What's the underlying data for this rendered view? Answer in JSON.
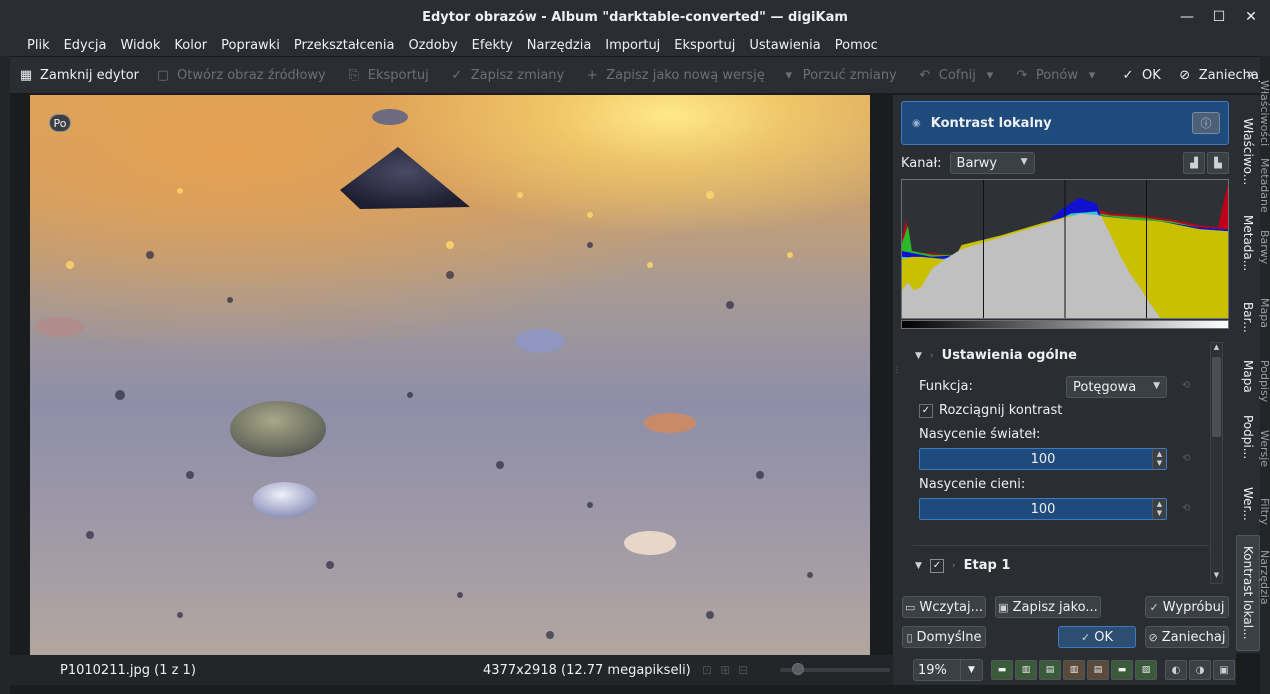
{
  "window": {
    "title": "Edytor obrazów - Album \"darktable-converted\" — digiKam"
  },
  "menu": [
    "Plik",
    "Edycja",
    "Widok",
    "Kolor",
    "Poprawki",
    "Przekształcenia",
    "Ozdoby",
    "Efekty",
    "Narzędzia",
    "Importuj",
    "Eksportuj",
    "Ustawienia",
    "Pomoc"
  ],
  "toolbar": {
    "close_editor": "Zamknij edytor",
    "open_source": "Otwórz obraz źródłowy",
    "export": "Eksportuj",
    "save_changes": "Zapisz zmiany",
    "save_new_version": "Zapisz jako nową wersję",
    "discard_changes": "Porzuć zmiany",
    "undo": "Cofnij",
    "redo": "Ponów",
    "ok": "OK",
    "cancel": "Zaniechaj",
    "more": "»"
  },
  "canvas": {
    "badge": "Po"
  },
  "status": {
    "filename": "P1010211.jpg (1 z 1)",
    "dimensions": "4377x2918 (12.77 megapikseli)"
  },
  "tool": {
    "name": "Kontrast lokalny",
    "channel_label": "Kanał:",
    "channel_value": "Barwy",
    "general_settings": "Ustawienia ogólne",
    "function_label": "Funkcja:",
    "function_value": "Potęgowa",
    "stretch_contrast": "Rozciągnij kontrast",
    "highlight_saturation_label": "Nasycenie świateł:",
    "highlight_saturation_value": "100",
    "shadow_saturation_label": "Nasycenie cieni:",
    "shadow_saturation_value": "100",
    "stage1": "Etap 1",
    "load_button": "Wczytaj...",
    "save_as_button": "Zapisz jako...",
    "try_button": "Wypróbuj",
    "defaults_button": "Domyślne",
    "ok_button": "OK",
    "cancel_button": "Zaniechaj"
  },
  "zoom": {
    "value": "19%"
  },
  "right_tabs": [
    "Właściwo...",
    "Metada...",
    "Bar...",
    "Mapa",
    "Podpi...",
    "Wer...",
    "Kontrast lokal..."
  ],
  "far_tabs": [
    "Właściwości",
    "Metadane",
    "Barwy",
    "Mapa",
    "Podpisy",
    "Wersje",
    "Filtry",
    "Narzędzia"
  ],
  "colors": {
    "accent": "#1e4a7c",
    "accent_border": "#3d7ac0",
    "bg": "#2a2e32"
  }
}
